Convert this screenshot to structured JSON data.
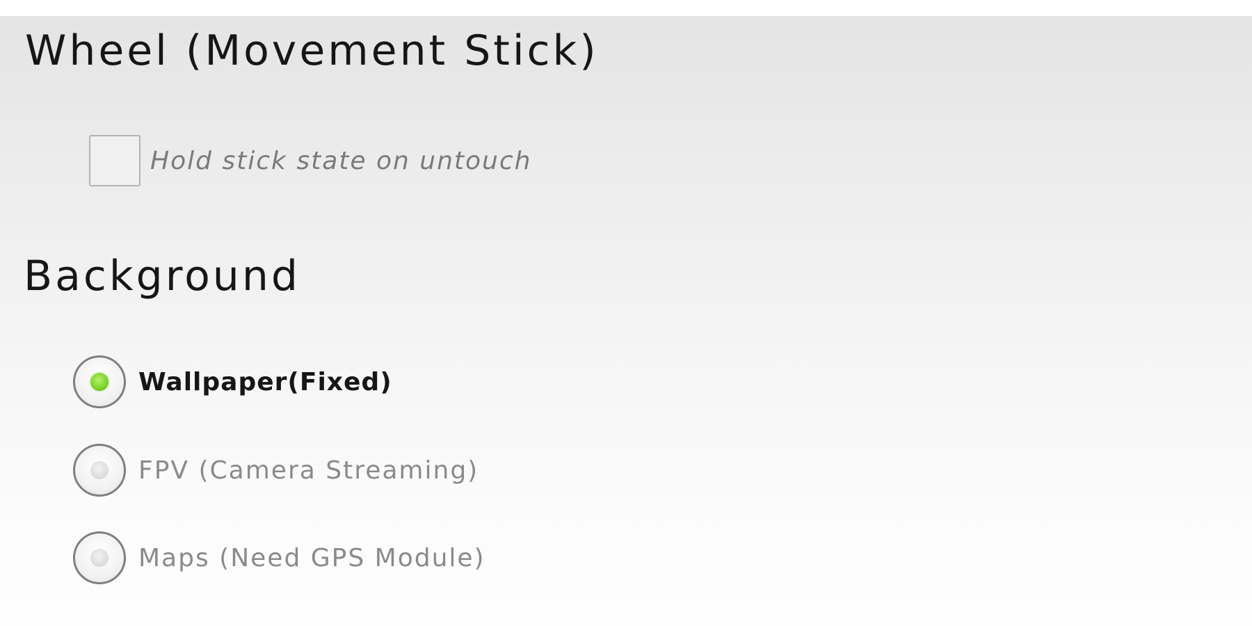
{
  "sections": {
    "wheel": {
      "title": "Wheel (Movement Stick)",
      "hold_stick": {
        "label": "Hold stick state on untouch",
        "checked": false
      }
    },
    "background": {
      "title": "Background",
      "selected": "Wallpaper(Fixed)",
      "options": [
        {
          "label": "Wallpaper(Fixed)",
          "checked": true
        },
        {
          "label": "FPV (Camera Streaming)",
          "checked": false
        },
        {
          "label": "Maps (Need GPS Module)",
          "checked": false
        }
      ]
    }
  },
  "colors": {
    "selected_radio": "#7ed52a",
    "heading_text": "#161616",
    "muted_text": "#8a8a8a"
  }
}
